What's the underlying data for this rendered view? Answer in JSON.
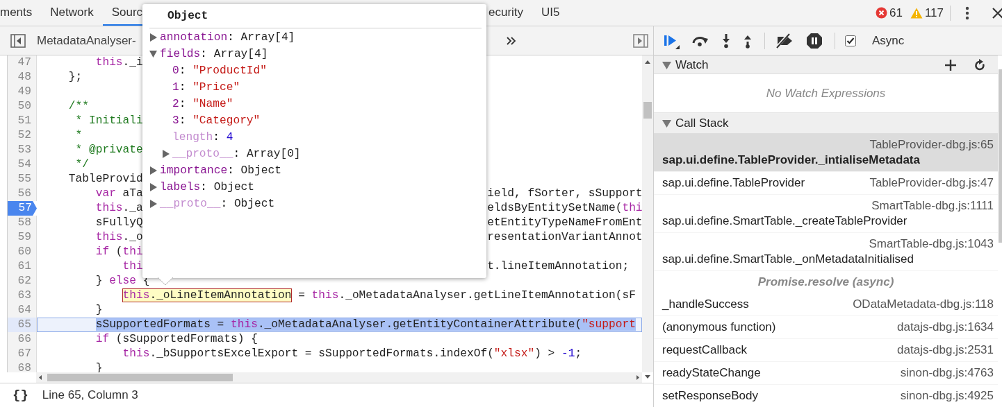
{
  "tabs": [
    {
      "label": "ments",
      "selected": false
    },
    {
      "label": "Network",
      "selected": false
    },
    {
      "label": "Sourc",
      "selected": true
    },
    {
      "label": "ecurity",
      "selected": false
    },
    {
      "label": "UI5",
      "selected": false
    }
  ],
  "issues": {
    "errors": "61",
    "warnings": "117"
  },
  "editor": {
    "file_tab": "MetadataAnalyser-",
    "lines": [
      {
        "number": "47",
        "breakpoint": false,
        "current": false,
        "left": [
          {
            "text": "        this",
            "kind": "keyword"
          },
          {
            "text": "._i",
            "kind": "plain"
          }
        ]
      },
      {
        "number": "48",
        "breakpoint": false,
        "current": false,
        "left": [
          {
            "text": "    };",
            "kind": "plain"
          }
        ]
      },
      {
        "number": "49",
        "breakpoint": false,
        "current": false
      },
      {
        "number": "50",
        "breakpoint": false,
        "current": false,
        "left": [
          {
            "text": "    /**",
            "kind": "comment"
          }
        ]
      },
      {
        "number": "51",
        "breakpoint": false,
        "current": false,
        "left": [
          {
            "text": "     * Initiali",
            "kind": "comment"
          }
        ]
      },
      {
        "number": "52",
        "breakpoint": false,
        "current": false,
        "left": [
          {
            "text": "     *",
            "kind": "comment"
          }
        ]
      },
      {
        "number": "53",
        "breakpoint": false,
        "current": false,
        "left": [
          {
            "text": "     * @private",
            "kind": "comment"
          }
        ]
      },
      {
        "number": "54",
        "breakpoint": false,
        "current": false,
        "left": [
          {
            "text": "     */",
            "kind": "comment"
          }
        ]
      },
      {
        "number": "55",
        "breakpoint": false,
        "current": false,
        "left": [
          {
            "text": "    TableProvid",
            "kind": "plain"
          }
        ]
      },
      {
        "number": "56",
        "breakpoint": false,
        "current": false,
        "left": [
          {
            "text": "        var",
            "kind": "keyword"
          },
          {
            "text": " aTa",
            "kind": "plain"
          }
        ],
        "right": [
          {
            "text": "ield, fSorter, sSupport",
            "kind": "plain"
          }
        ]
      },
      {
        "number": "57",
        "breakpoint": true,
        "current": false,
        "left": [
          {
            "text": "        this",
            "kind": "keyword"
          },
          {
            "text": "._a",
            "kind": "plain"
          }
        ],
        "right": [
          {
            "text": "eldsByEntitySetName(",
            "kind": "plain"
          },
          {
            "text": "thi",
            "kind": "keyword"
          }
        ]
      },
      {
        "number": "58",
        "breakpoint": false,
        "current": false,
        "left": [
          {
            "text": "        sFullyQ",
            "kind": "plain"
          }
        ],
        "right": [
          {
            "text": "etEntityTypeNameFromEnt",
            "kind": "plain"
          }
        ]
      },
      {
        "number": "59",
        "breakpoint": false,
        "current": false,
        "left": [
          {
            "text": "        this",
            "kind": "keyword"
          },
          {
            "text": "._o",
            "kind": "plain"
          }
        ],
        "right": [
          {
            "text": "resentationVariantAnnot",
            "kind": "plain"
          }
        ]
      },
      {
        "number": "60",
        "breakpoint": false,
        "current": false,
        "left": [
          {
            "text": "        if",
            "kind": "keyword"
          },
          {
            "text": " (",
            "kind": "plain"
          },
          {
            "text": "thi",
            "kind": "keyword"
          }
        ]
      },
      {
        "number": "61",
        "breakpoint": false,
        "current": false,
        "left": [
          {
            "text": "            thi",
            "kind": "keyword"
          }
        ],
        "right": [
          {
            "text": "t.lineItemAnnotation;",
            "kind": "plain"
          }
        ]
      },
      {
        "number": "62",
        "breakpoint": false,
        "current": false,
        "left": [
          {
            "text": "        } ",
            "kind": "plain"
          },
          {
            "text": "else",
            "kind": "keyword"
          },
          {
            "text": " {",
            "kind": "plain"
          }
        ]
      },
      {
        "number": "63",
        "breakpoint": false,
        "current": false,
        "left": [
          {
            "kind": "hover",
            "parts": [
              {
                "text": "            this",
                "kind": "keyword"
              },
              {
                "text": "._oLineItemAnnotation",
                "kind": "plain"
              }
            ]
          },
          {
            "text": " = ",
            "kind": "plain"
          },
          {
            "text": "this",
            "kind": "keyword"
          },
          {
            "text": "._oMetadataAnalyser.getLineItemAnnotation(sF",
            "kind": "plain"
          }
        ]
      },
      {
        "number": "64",
        "breakpoint": false,
        "current": false,
        "left": [
          {
            "text": "        }",
            "kind": "plain"
          }
        ]
      },
      {
        "number": "65",
        "breakpoint": false,
        "current": true,
        "left": [
          {
            "text": "        sSupportedFormats = ",
            "kind": "plain"
          },
          {
            "text": "this",
            "kind": "keyword"
          },
          {
            "text": "._oMetadataAnalyser.getEntityContainerAttribute(",
            "kind": "plain"
          },
          {
            "text": "\"support",
            "kind": "string"
          }
        ]
      },
      {
        "number": "66",
        "breakpoint": false,
        "current": false,
        "left": [
          {
            "text": "        if",
            "kind": "keyword"
          },
          {
            "text": " (sSupportedFormats) {",
            "kind": "plain"
          }
        ]
      },
      {
        "number": "67",
        "breakpoint": false,
        "current": false,
        "left": [
          {
            "text": "            this",
            "kind": "keyword"
          },
          {
            "text": "._bSupportsExcelExport = sSupportedFormats.indexOf(",
            "kind": "plain"
          },
          {
            "text": "\"xlsx\"",
            "kind": "string"
          },
          {
            "text": ") > ",
            "kind": "plain"
          },
          {
            "text": "-1",
            "kind": "number"
          },
          {
            "text": ";",
            "kind": "plain"
          }
        ]
      },
      {
        "number": "68",
        "breakpoint": false,
        "current": false,
        "left": [
          {
            "text": "        }",
            "kind": "plain"
          }
        ]
      }
    ]
  },
  "popup": {
    "title": "Object",
    "properties": [
      {
        "name": "annotation",
        "separator": ":",
        "value": "Array[4]",
        "kind": "object",
        "dimmed": false,
        "expanded": false
      },
      {
        "name": "fields",
        "separator": ":",
        "value": "Array[4]",
        "kind": "object",
        "dimmed": false,
        "expanded": true,
        "children": [
          {
            "name": "0",
            "separator": ":",
            "value": "\"ProductId\"",
            "kind": "string",
            "dimmed": false
          },
          {
            "name": "1",
            "separator": ":",
            "value": "\"Price\"",
            "kind": "string",
            "dimmed": false
          },
          {
            "name": "2",
            "separator": ":",
            "value": "\"Name\"",
            "kind": "string",
            "dimmed": false
          },
          {
            "name": "3",
            "separator": ":",
            "value": "\"Category\"",
            "kind": "string",
            "dimmed": false
          },
          {
            "name": "length",
            "separator": ":",
            "value": "4",
            "kind": "number",
            "dimmed": true
          },
          {
            "name": "__proto__",
            "separator": ":",
            "value": "Array[0]",
            "kind": "object",
            "dimmed": true,
            "expanded": false
          }
        ]
      },
      {
        "name": "importance",
        "separator": ":",
        "value": "Object",
        "kind": "object",
        "dimmed": false,
        "expanded": false
      },
      {
        "name": "labels",
        "separator": ":",
        "value": "Object",
        "kind": "object",
        "dimmed": false,
        "expanded": false
      },
      {
        "name": "__proto__",
        "separator": ":",
        "value": "Object",
        "kind": "object",
        "dimmed": true,
        "expanded": false
      }
    ]
  },
  "debugger": {
    "async": {
      "label": "Async",
      "checked": true
    },
    "watch": {
      "title": "Watch",
      "expanded": true,
      "empty_text": "No Watch Expressions"
    },
    "call_stack": {
      "title": "Call Stack",
      "expanded": true,
      "frames": [
        {
          "kind": "frame",
          "name": "sap.ui.define.TableProvider._intialiseMetadata",
          "location": "TableProvider-dbg.js:65",
          "selected": true
        },
        {
          "kind": "frame",
          "name": "sap.ui.define.TableProvider",
          "location": "TableProvider-dbg.js:47",
          "selected": false
        },
        {
          "kind": "frame",
          "name": "sap.ui.define.SmartTable._createTableProvider",
          "location": "SmartTable-dbg.js:1111",
          "selected": false
        },
        {
          "kind": "frame",
          "name": "sap.ui.define.SmartTable._onMetadataInitialised",
          "location": "SmartTable-dbg.js:1043",
          "selected": false
        },
        {
          "kind": "async",
          "name": "Promise.resolve (async)",
          "selected": false
        },
        {
          "kind": "frame",
          "name": "_handleSuccess",
          "location": "ODataMetadata-dbg.js:118",
          "selected": false
        },
        {
          "kind": "frame",
          "name": "(anonymous function)",
          "location": "datajs-dbg.js:1634",
          "selected": false
        },
        {
          "kind": "frame",
          "name": "requestCallback",
          "location": "datajs-dbg.js:2531",
          "selected": false
        },
        {
          "kind": "frame",
          "name": "readyStateChange",
          "location": "sinon-dbg.js:4763",
          "selected": false
        },
        {
          "kind": "frame",
          "name": "setResponseBody",
          "location": "sinon-dbg.js:4925",
          "selected": false
        }
      ]
    }
  },
  "status_bar": {
    "pretty_print": "{}",
    "position": "Line 65, Column 3"
  }
}
